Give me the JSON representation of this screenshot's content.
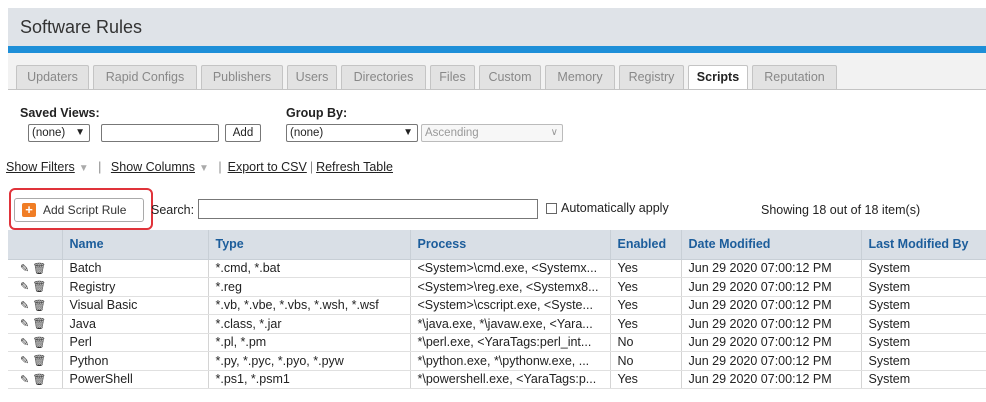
{
  "title": "Software Rules",
  "tabs": [
    {
      "label": "Updaters",
      "active": false
    },
    {
      "label": "Rapid Configs",
      "active": false
    },
    {
      "label": "Publishers",
      "active": false
    },
    {
      "label": "Users",
      "active": false
    },
    {
      "label": "Directories",
      "active": false
    },
    {
      "label": "Files",
      "active": false
    },
    {
      "label": "Custom",
      "active": false
    },
    {
      "label": "Memory",
      "active": false
    },
    {
      "label": "Registry",
      "active": false
    },
    {
      "label": "Scripts",
      "active": true
    },
    {
      "label": "Reputation",
      "active": false
    }
  ],
  "saved_views": {
    "label": "Saved Views:",
    "selected": "(none)",
    "add_button": "Add"
  },
  "group_by": {
    "label": "Group By:",
    "selected": "(none)",
    "order": "Ascending"
  },
  "links": {
    "show_filters": "Show Filters",
    "show_columns": "Show Columns",
    "export": "Export to CSV",
    "refresh": "Refresh Table"
  },
  "add_rule_button": "Add Script Rule",
  "search": {
    "label": "Search:",
    "value": ""
  },
  "auto_apply": {
    "label": "Automatically apply",
    "checked": false
  },
  "showing": "Showing 18 out of 18 item(s)",
  "columns": [
    "Name",
    "Type",
    "Process",
    "Enabled",
    "Date Modified",
    "Last Modified By"
  ],
  "rows": [
    {
      "name": "Batch",
      "type": "*.cmd, *.bat",
      "process": "<System>\\cmd.exe, <Systemx...",
      "enabled": "Yes",
      "date": "Jun 29 2020 07:00:12 PM",
      "by": "System"
    },
    {
      "name": "Registry",
      "type": "*.reg",
      "process": "<System>\\reg.exe, <Systemx8...",
      "enabled": "Yes",
      "date": "Jun 29 2020 07:00:12 PM",
      "by": "System"
    },
    {
      "name": "Visual Basic",
      "type": "*.vb, *.vbe, *.vbs, *.wsh, *.wsf",
      "process": "<System>\\cscript.exe, <Syste...",
      "enabled": "Yes",
      "date": "Jun 29 2020 07:00:12 PM",
      "by": "System"
    },
    {
      "name": "Java",
      "type": "*.class, *.jar",
      "process": "*\\java.exe, *\\javaw.exe, <Yara...",
      "enabled": "Yes",
      "date": "Jun 29 2020 07:00:12 PM",
      "by": "System"
    },
    {
      "name": "Perl",
      "type": "*.pl, *.pm",
      "process": "*\\perl.exe, <YaraTags:perl_int...",
      "enabled": "No",
      "date": "Jun 29 2020 07:00:12 PM",
      "by": "System"
    },
    {
      "name": "Python",
      "type": "*.py, *.pyc, *.pyo, *.pyw",
      "process": "*\\python.exe, *\\pythonw.exe, ...",
      "enabled": "No",
      "date": "Jun 29 2020 07:00:12 PM",
      "by": "System"
    },
    {
      "name": "PowerShell",
      "type": "*.ps1, *.psm1",
      "process": "*\\powershell.exe, <YaraTags:p...",
      "enabled": "Yes",
      "date": "Jun 29 2020 07:00:12 PM",
      "by": "System"
    }
  ]
}
